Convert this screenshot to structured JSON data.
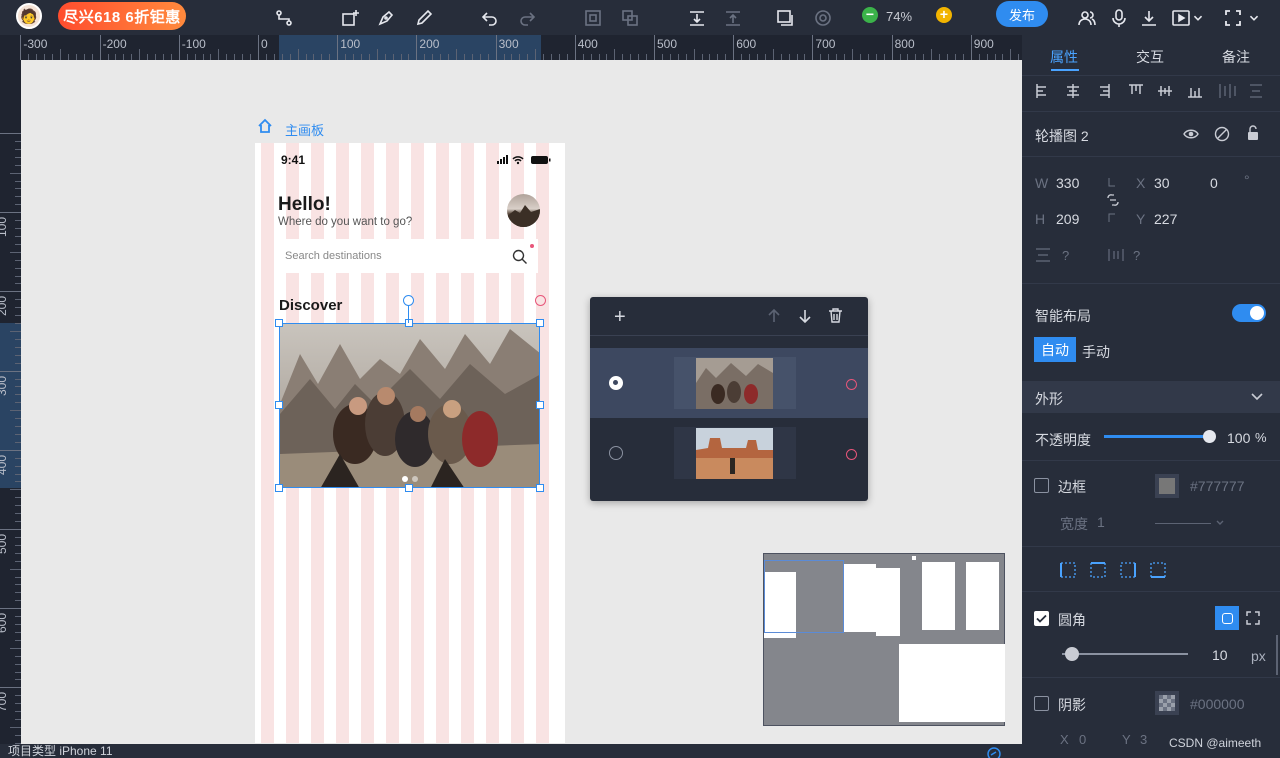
{
  "toolbar": {
    "promo": "尽兴618 6折钜惠",
    "zoom": "74%",
    "publish": "发布"
  },
  "ruler": {
    "top_labels": [
      "-300",
      "-200",
      "-100",
      "0",
      "100",
      "200",
      "300",
      "400",
      "500",
      "600",
      "700",
      "800",
      "900"
    ],
    "left_labels": [
      "0",
      "100",
      "200",
      "300",
      "400",
      "500",
      "600",
      "700"
    ]
  },
  "breadcrumb": {
    "home": "主画板"
  },
  "phone": {
    "time": "9:41",
    "greeting": "Hello!",
    "subtitle": "Where do you want to go?",
    "search_placeholder": "Search destinations",
    "section": "Discover"
  },
  "panel": {
    "tabs": [
      "属性",
      "交互",
      "备注"
    ],
    "component_name": "轮播图 2",
    "w_label": "W",
    "w_value": "330",
    "h_label": "H",
    "h_value": "209",
    "x_label": "X",
    "x_value": "30",
    "y_label": "Y",
    "y_value": "227",
    "rotation": "0",
    "rotation_unit": "°",
    "q1": "?",
    "q2": "?",
    "smart_layout": "智能布局",
    "auto": "自动",
    "manual": "手动",
    "appearance": "外形",
    "opacity_label": "不透明度",
    "opacity_value": "100",
    "opacity_unit": "%",
    "opacity": 1.0,
    "border_label": "边框",
    "border_color": "#777777",
    "border_width_label": "宽度",
    "border_width": "1",
    "radius_label": "圆角",
    "radius_value": "10",
    "radius_unit": "px",
    "shadow_label": "阴影",
    "shadow_color": "#000000",
    "shadow_x_label": "X",
    "shadow_x": "0",
    "shadow_y_label": "Y",
    "shadow_y": "3",
    "watermark": "CSDN @aimeeth"
  },
  "bottombar": {
    "text": "项目类型 iPhone 11"
  },
  "colors": {
    "accent": "#2f8cf0",
    "toolbar": "#272d3a",
    "stripe": "#f9e3e3"
  }
}
